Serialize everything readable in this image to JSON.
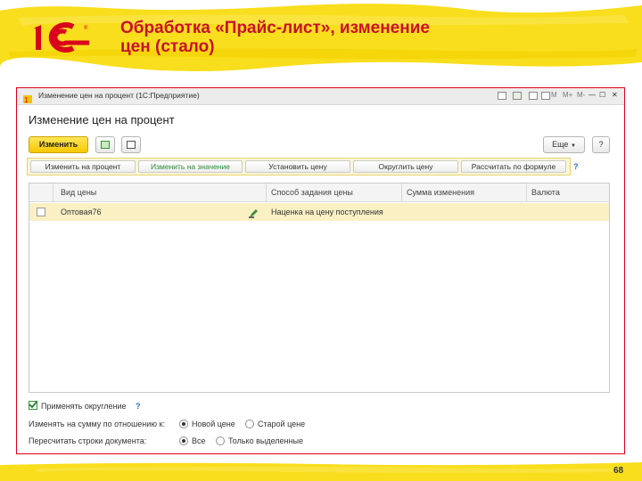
{
  "slide": {
    "title_line1": "Обработка «Прайс-лист», изменение",
    "title_line2": "цен (стало)",
    "page_number": "68",
    "logo_text": "1С"
  },
  "window": {
    "title": "Изменение цен на процент  (1С:Предприятие)",
    "controls": [
      "M",
      "M+",
      "M-",
      "—",
      "☐",
      "✕"
    ]
  },
  "form": {
    "title": "Изменение цен на процент",
    "change_button": "Изменить",
    "more_button": "Еще",
    "help_button": "?"
  },
  "commands": {
    "items": [
      "Изменить на процент",
      "Изменить на значение",
      "Установить цену",
      "Округлить цену",
      "Рассчитать по формуле"
    ],
    "help": "?"
  },
  "table": {
    "columns": [
      "Вид цены",
      "Способ задания цены",
      "Сумма изменения",
      "Валюта"
    ],
    "rows": [
      {
        "price_type": "Оптовая76",
        "method": "Наценка на цену поступления",
        "sum": "",
        "currency": ""
      }
    ]
  },
  "options": {
    "rounding_label": "Применять округление",
    "rounding_help": "?",
    "change_relative_label": "Изменять на сумму по отношению к:",
    "new_price": "Новой цене",
    "old_price": "Старой цене",
    "recalc_label": "Пересчитать строки документа:",
    "all_rows": "Все",
    "selected_only": "Только выделенные"
  },
  "colors": {
    "accent_title": "#c8102e",
    "highlight": "#f6d800",
    "frame": "#d9001b"
  }
}
